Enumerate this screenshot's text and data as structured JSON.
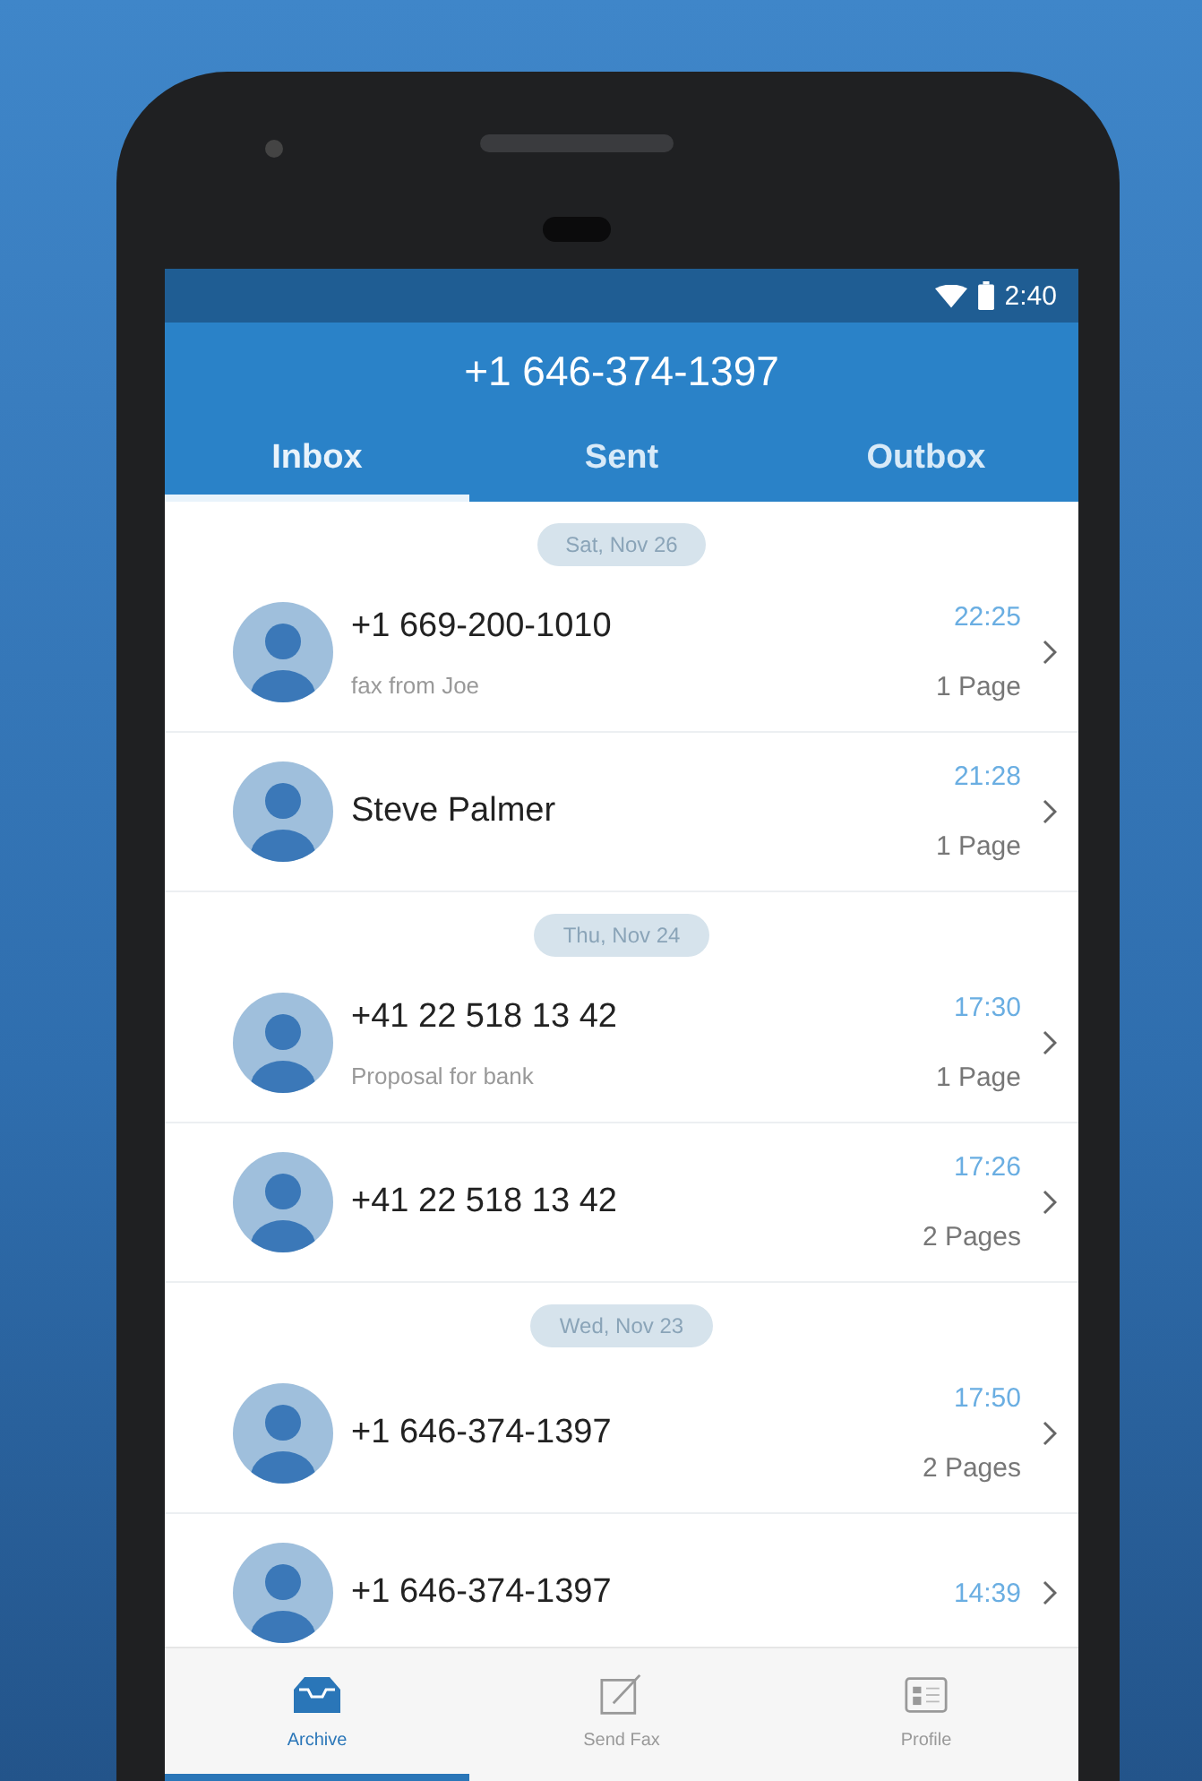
{
  "status_bar": {
    "time": "2:40"
  },
  "header": {
    "title": "+1 646-374-1397"
  },
  "tabs": [
    {
      "label": "Inbox",
      "selected": true
    },
    {
      "label": "Sent",
      "selected": false
    },
    {
      "label": "Outbox",
      "selected": false
    }
  ],
  "groups": [
    {
      "date": "Sat, Nov 26",
      "items": [
        {
          "name": "+1 669-200-1010",
          "subtitle": "fax from Joe",
          "time": "22:25",
          "pages": "1 Page"
        },
        {
          "name": "Steve Palmer",
          "time": "21:28",
          "pages": "1 Page"
        }
      ]
    },
    {
      "date": "Thu, Nov 24",
      "items": [
        {
          "name": "+41 22 518 13 42",
          "subtitle": "Proposal for bank",
          "time": "17:30",
          "pages": "1 Page"
        },
        {
          "name": "+41 22 518 13 42",
          "time": "17:26",
          "pages": "2 Pages"
        }
      ]
    },
    {
      "date": "Wed, Nov 23",
      "items": [
        {
          "name": "+1 646-374-1397",
          "time": "17:50",
          "pages": "2 Pages"
        },
        {
          "name": "+1 646-374-1397",
          "time": "14:39"
        }
      ]
    }
  ],
  "bottom_nav": [
    {
      "label": "Archive",
      "selected": true
    },
    {
      "label": "Send Fax",
      "selected": false
    },
    {
      "label": "Profile",
      "selected": false
    }
  ]
}
